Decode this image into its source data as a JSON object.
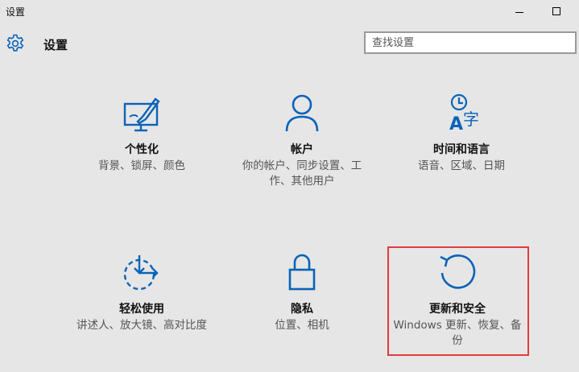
{
  "window": {
    "title": "设置"
  },
  "header": {
    "title": "设置",
    "search_placeholder": "查找设置"
  },
  "tiles": [
    {
      "label": "个性化",
      "desc": "背景、锁屏、颜色"
    },
    {
      "label": "帐户",
      "desc": "你的帐户、同步设置、工作、其他用户"
    },
    {
      "label": "时间和语言",
      "desc": "语音、区域、日期"
    },
    {
      "label": "轻松使用",
      "desc": "讲述人、放大镜、高对比度"
    },
    {
      "label": "隐私",
      "desc": "位置、相机"
    },
    {
      "label": "更新和安全",
      "desc": "Windows 更新、恢复、备份"
    }
  ],
  "colors": {
    "accent": "#0a63b8",
    "highlight_border": "#e03c3c",
    "background": "#e6e6e6"
  },
  "icons": [
    "gear-icon",
    "personalization-icon",
    "account-icon",
    "time-language-icon",
    "ease-of-access-icon",
    "privacy-lock-icon",
    "update-refresh-icon"
  ]
}
